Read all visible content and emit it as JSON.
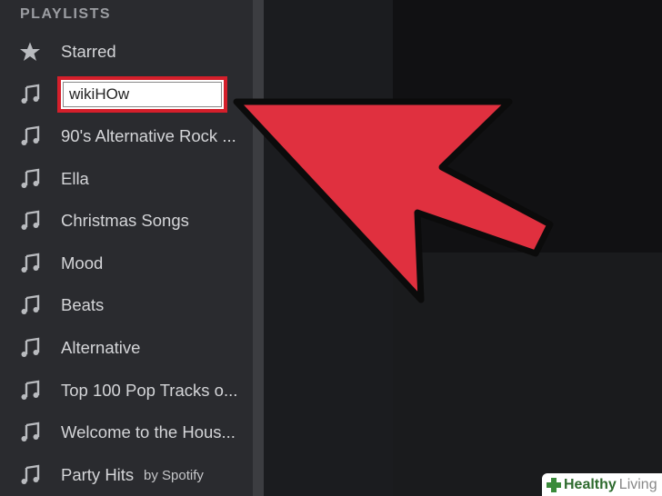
{
  "sidebar": {
    "header": "PLAYLISTS",
    "starred": {
      "label": "Starred",
      "icon": "star-icon"
    },
    "rename_value": "wikiHOw",
    "items": [
      {
        "label": "90's Alternative Rock ..."
      },
      {
        "label": "Ella"
      },
      {
        "label": "Christmas Songs"
      },
      {
        "label": "Mood"
      },
      {
        "label": "Beats"
      },
      {
        "label": "Alternative"
      },
      {
        "label": "Top 100 Pop Tracks o..."
      },
      {
        "label": "Welcome to the Hous..."
      },
      {
        "label": "Party Hits",
        "suffix": "by Spotify"
      }
    ],
    "playlist_icon": "music-note-icon"
  },
  "annotation": {
    "arrow_color": "#e0303f",
    "highlight_color": "#d41f2b"
  },
  "watermark": {
    "word1": "Healthy",
    "word2": "Living"
  }
}
